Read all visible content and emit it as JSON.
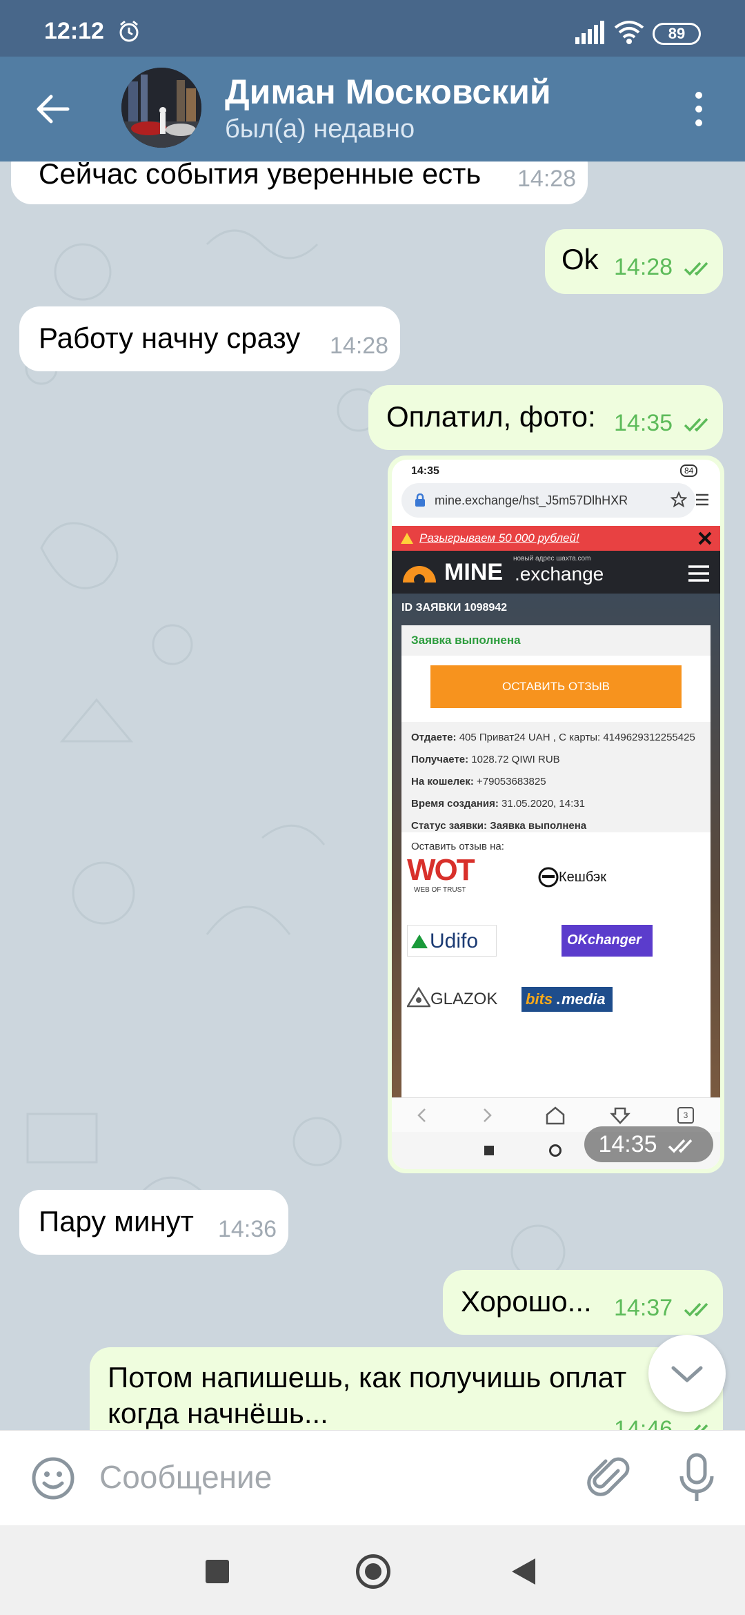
{
  "status_bar": {
    "time": "12:12",
    "battery": "89"
  },
  "header": {
    "name": "Диман Московский",
    "status": "был(а) недавно"
  },
  "messages": [
    {
      "dir": "in",
      "text": "Сейчас события уверенные есть",
      "time": "14:28"
    },
    {
      "dir": "out",
      "text": "Ok",
      "time": "14:28"
    },
    {
      "dir": "in",
      "text": "Работу начну сразу",
      "time": "14:28"
    },
    {
      "dir": "out",
      "text": "Оплатил, фото:",
      "time": "14:35"
    },
    {
      "dir": "out",
      "type": "photo",
      "time": "14:35"
    },
    {
      "dir": "in",
      "text": "Пару минут",
      "time": "14:36"
    },
    {
      "dir": "out",
      "text": "Хорошо...",
      "time": "14:37"
    },
    {
      "dir": "out",
      "text_line1": "Потом напишешь, как получишь оплат",
      "text_line2": "когда начнёшь...",
      "time": "14:46"
    }
  ],
  "photo": {
    "status_time": "14:35",
    "status_battery": "84",
    "url": "mine.exchange/hst_J5m57DlhHXR",
    "banner": "Разыгрываем 50 000 рублей!",
    "site_name_bold": "MINE",
    "site_name_rest": ".exchange",
    "site_tagline": "новый адрес шахта.com",
    "order_id": "ID ЗАЯВКИ 1098942",
    "card_header": "Заявка выполнена",
    "review_button": "ОСТАВИТЬ ОТЗЫВ",
    "give_label": "Отдаете:",
    "give_value": "405 Приват24 UAH , С карты: 4149629312255425",
    "get_label": "Получаете:",
    "get_value": "1028.72 QIWI RUB",
    "wallet_label": "На кошелек:",
    "wallet_value": "+79053683825",
    "created_label": "Время создания:",
    "created_value": "31.05.2020, 14:31",
    "status_label": "Статус заявки:",
    "status_value": "Заявка выполнена",
    "review_on": "Оставить отзыв на:",
    "logos": {
      "wot": "WOT",
      "wot_sub": "WEB OF TRUST",
      "cashback": "Кешбэк",
      "udifo": "Udifo",
      "okchanger": "OKchanger",
      "glazok": "GLAZOK",
      "bits": "bits",
      "bits_media": "media"
    },
    "tab_count": "3"
  },
  "input": {
    "placeholder": "Сообщение"
  },
  "colors": {
    "header": "#527da3",
    "status_bar": "#48678a",
    "outgoing_bubble": "#effdde",
    "incoming_bubble": "#ffffff",
    "check": "#5dbb5a"
  }
}
